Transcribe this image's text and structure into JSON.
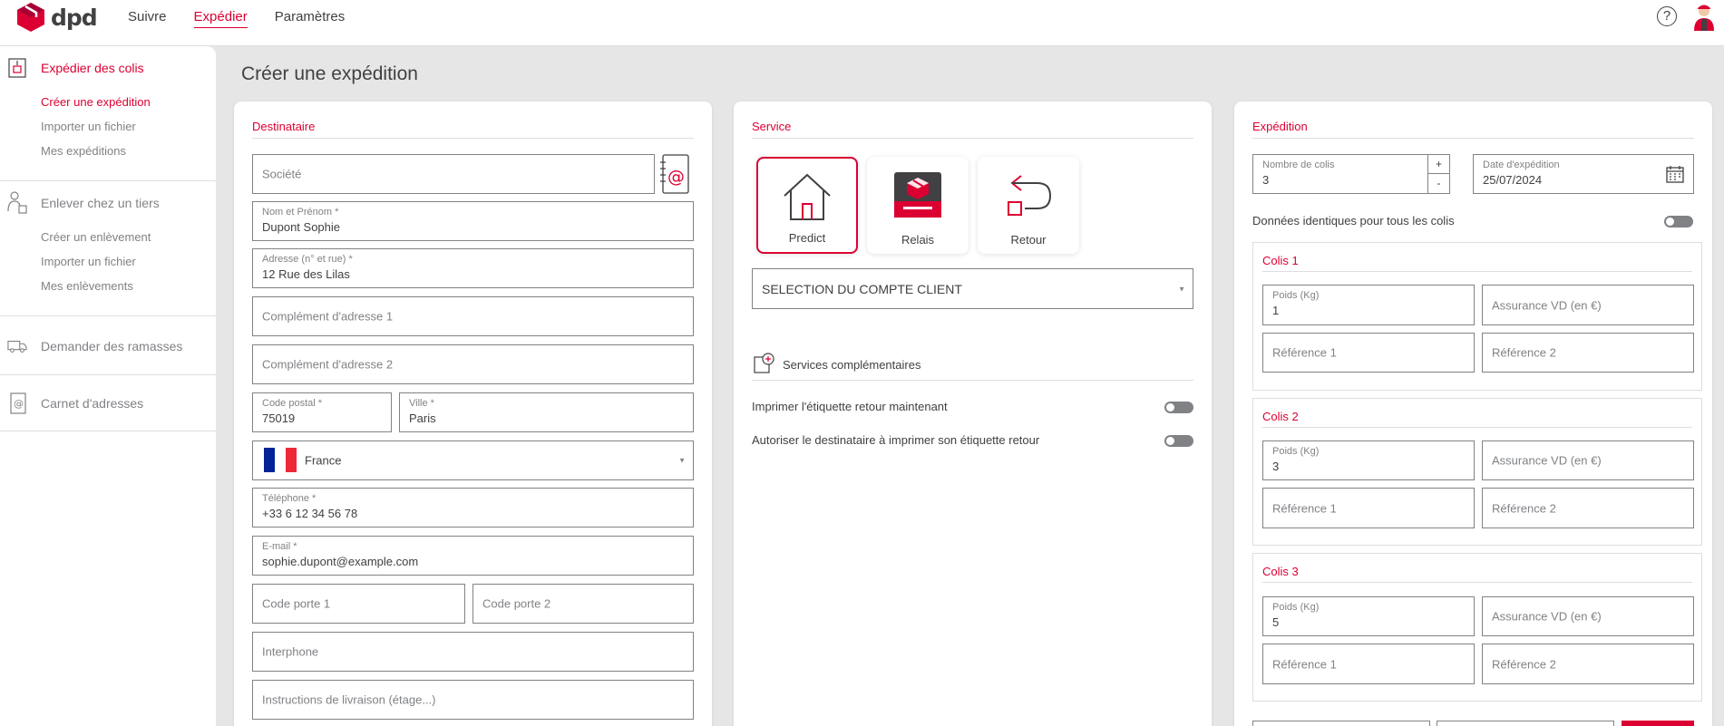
{
  "brand": {
    "name": "dpd",
    "color": "#dc0032"
  },
  "nav": {
    "items": [
      "Suivre",
      "Expédier",
      "Paramètres"
    ],
    "active": "Expédier"
  },
  "header": {
    "help_icon": "help-icon",
    "help_glyph": "?"
  },
  "sidebar": {
    "sections": [
      {
        "label": "Expédier des colis",
        "icon": "parcel-icon",
        "active": true,
        "items": [
          {
            "label": "Créer une expédition",
            "active": true
          },
          {
            "label": "Importer un fichier"
          },
          {
            "label": "Mes expéditions"
          }
        ]
      },
      {
        "label": "Enlever chez un tiers",
        "icon": "person-pickup-icon",
        "items": [
          {
            "label": "Créer un enlèvement"
          },
          {
            "label": "Importer un fichier"
          },
          {
            "label": "Mes enlèvements"
          }
        ]
      },
      {
        "label": "Demander des ramasses",
        "icon": "truck-icon",
        "items": []
      },
      {
        "label": "Carnet d'adresses",
        "icon": "address-book-icon",
        "items": []
      }
    ]
  },
  "page": {
    "title": "Créer une expédition"
  },
  "destinataire": {
    "title": "Destinataire",
    "societe_ph": "Société",
    "nom_label": "Nom et Prénom *",
    "nom_value": "Dupont Sophie",
    "adresse_label": "Adresse (n° et rue) *",
    "adresse_value": "12 Rue des Lilas",
    "complement1_ph": "Complément d'adresse 1",
    "complement2_ph": "Complément d'adresse 2",
    "cp_label": "Code postal *",
    "cp_value": "75019",
    "ville_label": "Ville *",
    "ville_value": "Paris",
    "pays_value": "France",
    "tel_label": "Téléphone *",
    "tel_value": "+33 6 12 34 56 78",
    "email_label": "E-mail *",
    "email_value": "sophie.dupont@example.com",
    "codeporte1_ph": "Code porte 1",
    "codeporte2_ph": "Code porte 2",
    "interphone_ph": "Interphone",
    "instructions_ph": "Instructions de livraison (étage...)"
  },
  "service": {
    "title": "Service",
    "cards": [
      {
        "label": "Predict",
        "selected": true
      },
      {
        "label": "Relais"
      },
      {
        "label": "Retour"
      }
    ],
    "compte_ph": "SELECTION DU COMPTE CLIENT",
    "complementaires": "Services complémentaires",
    "toggle1": "Imprimer l'étiquette retour maintenant",
    "toggle2": "Autoriser le destinataire à imprimer son étiquette retour"
  },
  "expedition": {
    "title": "Expédition",
    "nb_label": "Nombre de colis",
    "nb_value": "3",
    "plus": "+",
    "minus": "-",
    "date_label": "Date d'expédition",
    "date_value": "25/07/2024",
    "identiques": "Données identiques pour tous les colis",
    "colis": [
      {
        "title": "Colis 1",
        "poids_label": "Poids (Kg)",
        "poids": "1",
        "assurance_ph": "Assurance VD (en €)",
        "ref1_ph": "Référence 1",
        "ref2_ph": "Référence 2"
      },
      {
        "title": "Colis 2",
        "poids_label": "Poids (Kg)",
        "poids": "3",
        "assurance_ph": "Assurance VD (en €)",
        "ref1_ph": "Référence 1",
        "ref2_ph": "Référence 2"
      },
      {
        "title": "Colis 3",
        "poids_label": "Poids (Kg)",
        "poids": "5",
        "assurance_ph": "Assurance VD (en €)",
        "ref1_ph": "Référence 1",
        "ref2_ph": "Référence 2"
      }
    ]
  }
}
